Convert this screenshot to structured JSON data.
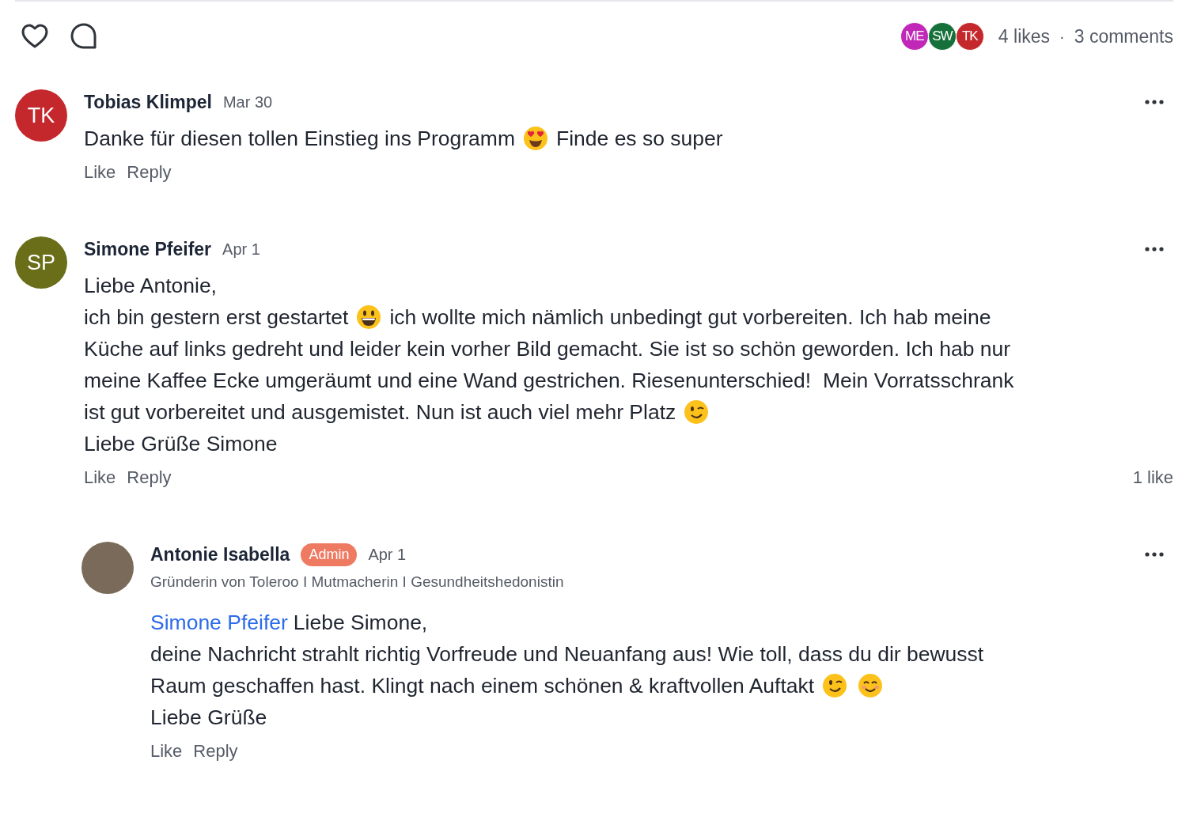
{
  "summary": {
    "avatars": [
      {
        "initials": "ME",
        "color": "#c128b8"
      },
      {
        "initials": "SW",
        "color": "#16703a"
      },
      {
        "initials": "TK",
        "color": "#c4282d"
      }
    ],
    "likes": "4 likes",
    "separator": "·",
    "comments": "3 comments"
  },
  "comments": [
    {
      "author": "Tobias Klimpel",
      "avatar": {
        "kind": "initials",
        "initials": "TK",
        "color": "#c4282d"
      },
      "date": "Mar 30",
      "lines": [
        [
          {
            "kind": "text",
            "text": "Danke für diesen tollen Einstieg ins Programm"
          },
          {
            "kind": "hearteyes"
          },
          {
            "kind": "text",
            "text": "Finde es so super"
          }
        ]
      ],
      "actions": [
        "Like",
        "Reply"
      ]
    },
    {
      "author": "Simone Pfeifer",
      "avatar": {
        "kind": "initials",
        "initials": "SP",
        "color": "#6a6e19"
      },
      "date": "Apr 1",
      "lines": [
        [
          {
            "kind": "text",
            "text": "Liebe Antonie,"
          }
        ],
        [
          {
            "kind": "text",
            "text": "ich bin gestern erst gestartet"
          },
          {
            "kind": "grin"
          },
          {
            "kind": "text",
            "text": "ich wollte mich nämlich unbedingt gut vorbereiten. Ich hab meine"
          }
        ],
        [
          {
            "kind": "text",
            "text": "Küche auf links gedreht und leider kein vorher Bild gemacht. Sie ist so schön geworden. Ich hab nur"
          }
        ],
        [
          {
            "kind": "text",
            "text": "meine Kaffee Ecke umgeräumt und eine Wand gestrichen. Riesenunterschied!  Mein Vorratsschrank"
          }
        ],
        [
          {
            "kind": "text",
            "text": "ist gut vorbereitet und ausgemistet. Nun ist auch viel mehr Platz"
          },
          {
            "kind": "wink"
          }
        ],
        [
          {
            "kind": "text",
            "text": "Liebe Grüße Simone"
          }
        ]
      ],
      "actions": [
        "Like",
        "Reply"
      ],
      "like_count": "1 like",
      "replies": [
        {
          "author": "Antonie Isabella",
          "avatar": {
            "kind": "photo"
          },
          "badge": "Admin",
          "date": "Apr 1",
          "headline": "Gründerin von Toleroo I Mutmacherin I Gesundheitshedonistin",
          "lines": [
            [
              {
                "kind": "mention",
                "text": "Simone Pfeifer"
              },
              {
                "kind": "text",
                "text": "Liebe Simone,"
              }
            ],
            [
              {
                "kind": "text",
                "text": "deine Nachricht strahlt richtig Vorfreude und Neuanfang aus! Wie toll, dass du dir bewusst"
              }
            ],
            [
              {
                "kind": "text",
                "text": "Raum geschaffen hast. Klingt nach einem schönen & kraftvollen Auftakt"
              },
              {
                "kind": "wink"
              },
              {
                "kind": "smile"
              }
            ],
            [
              {
                "kind": "text",
                "text": "Liebe Grüße"
              }
            ]
          ],
          "actions": [
            "Like",
            "Reply"
          ]
        }
      ]
    }
  ]
}
